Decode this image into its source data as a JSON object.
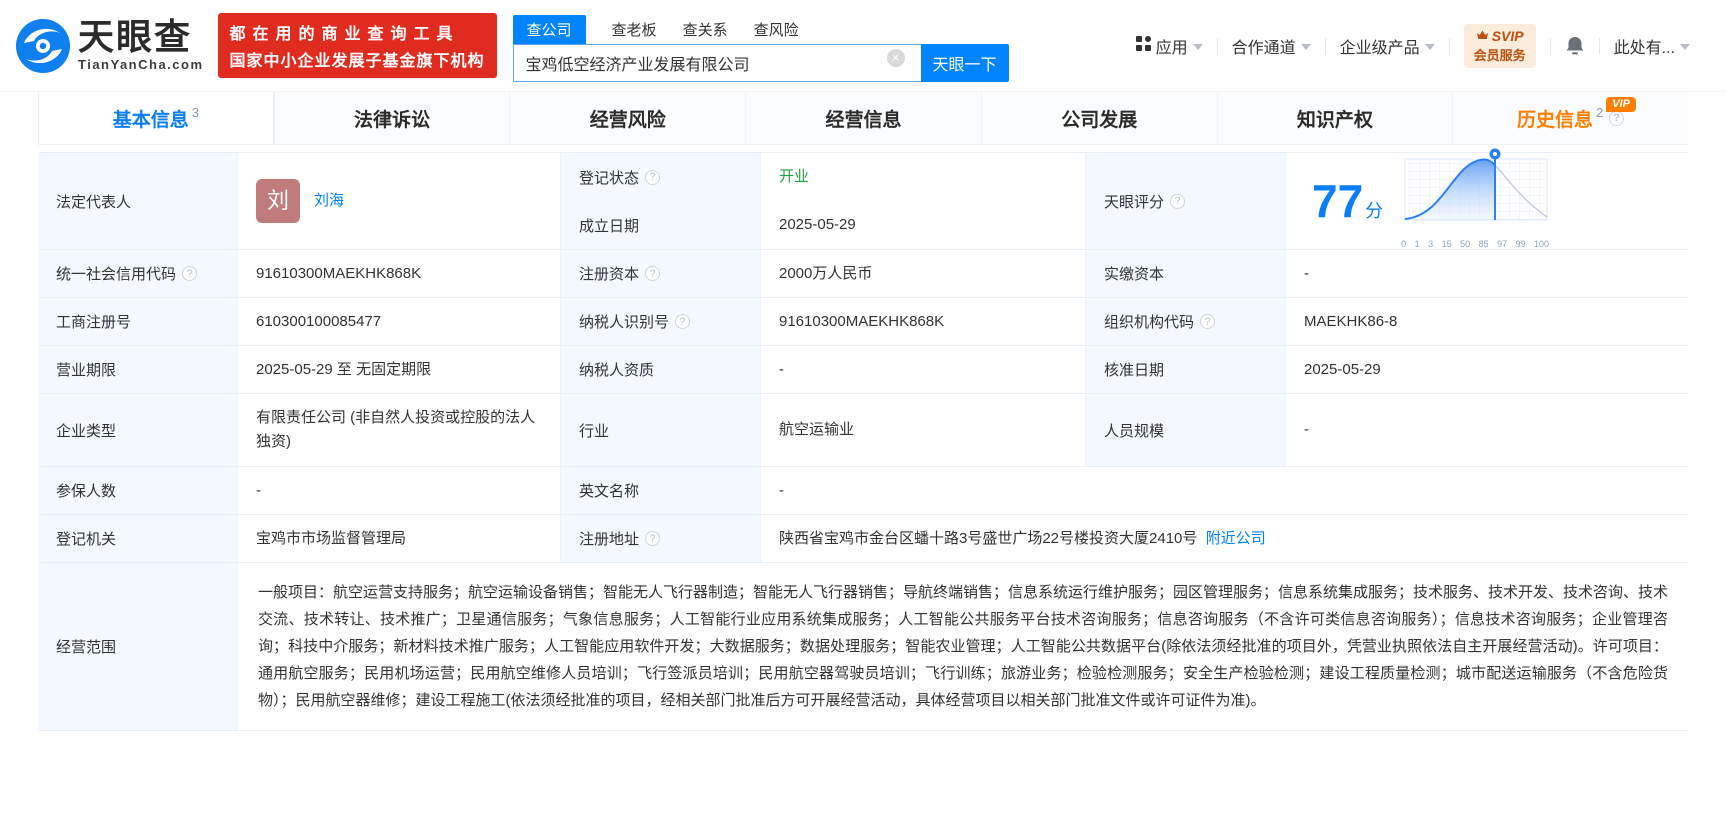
{
  "brand": {
    "name": "天眼查",
    "domain": "TianYanCha.com",
    "slogan_line1": "都在用的商业查询工具",
    "slogan_line2": "国家中小企业发展子基金旗下机构"
  },
  "search": {
    "tabs": [
      "查公司",
      "查老板",
      "查关系",
      "查风险"
    ],
    "value": "宝鸡低空经济产业发展有限公司",
    "button_label": "天眼一下"
  },
  "header_menu": {
    "apps": "应用",
    "partner_channel": "合作通道",
    "enterprise_products": "企业级产品",
    "svip_top": "SVIP",
    "svip_bottom": "会员服务",
    "more": "此处有..."
  },
  "nav_tabs": {
    "basic": "基本信息",
    "basic_count": "3",
    "legal": "法律诉讼",
    "risk": "经营风险",
    "business": "经营信息",
    "development": "公司发展",
    "ip": "知识产权",
    "history": "历史信息",
    "history_count": "2",
    "vip_badge": "VIP"
  },
  "profile": {
    "legal_rep": {
      "label": "法定代表人",
      "avatar_char": "刘",
      "name": "刘海"
    },
    "reg_status": {
      "label": "登记状态",
      "value": "开业"
    },
    "establish_date": {
      "label": "成立日期",
      "value": "2025-05-29"
    },
    "score": {
      "label": "天眼评分",
      "value": "77",
      "unit": "分"
    },
    "rows": [
      {
        "cells": [
          {
            "label": "统一社会信用代码",
            "value": "91610300MAEKHK868K"
          },
          {
            "label": "注册资本",
            "value": "2000万人民币"
          },
          {
            "label": "实缴资本",
            "value": "-"
          }
        ]
      },
      {
        "cells": [
          {
            "label": "工商注册号",
            "value": "610300100085477"
          },
          {
            "label": "纳税人识别号",
            "value": "91610300MAEKHK868K"
          },
          {
            "label": "组织机构代码",
            "value": "MAEKHK86-8"
          }
        ]
      },
      {
        "cells": [
          {
            "label": "营业期限",
            "value": "2025-05-29 至 无固定期限"
          },
          {
            "label": "纳税人资质",
            "value": "-"
          },
          {
            "label": "核准日期",
            "value": "2025-05-29"
          }
        ]
      },
      {
        "cells": [
          {
            "label": "企业类型",
            "value": "有限责任公司 (非自然人投资或控股的法人独资)"
          },
          {
            "label": "行业",
            "value": "航空运输业"
          },
          {
            "label": "人员规模",
            "value": "-"
          }
        ]
      },
      {
        "cells": [
          {
            "label": "参保人数",
            "value": "-"
          },
          {
            "label": "英文名称",
            "value": "-"
          }
        ]
      },
      {
        "cells": [
          {
            "label": "登记机关",
            "value": "宝鸡市市场监督管理局"
          },
          {
            "label": "注册地址",
            "value": "陕西省宝鸡市金台区蟠十路3号盛世广场22号楼投资大厦2410号"
          }
        ]
      }
    ],
    "address_link": "附近公司",
    "scope": {
      "label": "经营范围",
      "text": "一般项目：航空运营支持服务；航空运输设备销售；智能无人飞行器制造；智能无人飞行器销售；导航终端销售；信息系统运行维护服务；园区管理服务；信息系统集成服务；技术服务、技术开发、技术咨询、技术交流、技术转让、技术推广；卫星通信服务；气象信息服务；人工智能行业应用系统集成服务；人工智能公共服务平台技术咨询服务；信息咨询服务（不含许可类信息咨询服务）；信息技术咨询服务；企业管理咨询；科技中介服务；新材料技术推广服务；人工智能应用软件开发；大数据服务；数据处理服务；智能农业管理；人工智能公共数据平台(除依法须经批准的项目外，凭营业执照依法自主开展经营活动)。许可项目：通用航空服务；民用机场运营；民用航空维修人员培训；飞行签派员培训；民用航空器驾驶员培训；飞行训练；旅游业务；检验检测服务；安全生产检验检测；建设工程质量检测；城市配送运输服务（不含危险货物）；民用航空器维修；建设工程施工(依法须经批准的项目，经相关部门批准后方可开展经营活动，具体经营项目以相关部门批准文件或许可证件为准)。"
    }
  },
  "chart_data": {
    "type": "area",
    "title": "天眼评分分布曲线",
    "marker_value": 77,
    "x_ticks": [
      "0",
      "1",
      "3",
      "15",
      "50",
      "85",
      "97",
      "99",
      "100"
    ],
    "accent_color": "#2e7ff2",
    "grid": true
  },
  "colors": {
    "brand_blue": "#0084ff",
    "banner_red": "#e02b20",
    "status_green": "#28a047",
    "history_orange": "#ff8000",
    "label_bg": "#f3f9fe"
  }
}
